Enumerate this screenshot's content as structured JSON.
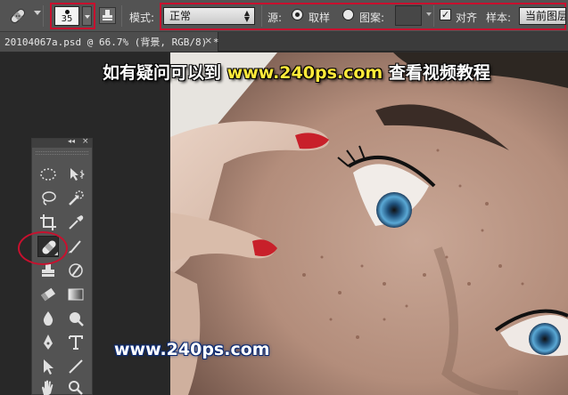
{
  "options_bar": {
    "brush_size": "35",
    "mode_label": "模式:",
    "mode_value": "正常",
    "source_label": "源:",
    "sampled_label": "取样",
    "pattern_label": "图案:",
    "aligned_label": "对齐",
    "sample_label": "样本:",
    "sample_value": "当前图层"
  },
  "document_tab": {
    "title": "20104067a.psd @ 66.7% (背景, RGB/8) *",
    "close": "×"
  },
  "watermark": {
    "top_prefix": "如有疑问可以到",
    "top_url": "www.240ps.com",
    "top_suffix": "查看视频教程",
    "bottom_url": "www.240ps.com"
  },
  "toolbox": {
    "collapse_glyph": "◂◂",
    "close_glyph": "×",
    "tools": [
      "elliptical-marquee",
      "move",
      "lasso",
      "quick-selection",
      "crop",
      "eyedropper",
      "spot-healing-brush",
      "brush",
      "clone-stamp",
      "history-brush",
      "eraser",
      "gradient",
      "blur",
      "dodge",
      "pen",
      "type",
      "path-selection",
      "line",
      "hand",
      "zoom"
    ]
  },
  "colors": {
    "highlight": "#c8102e",
    "url_yellow": "#ffea3a",
    "panel": "#535353"
  }
}
